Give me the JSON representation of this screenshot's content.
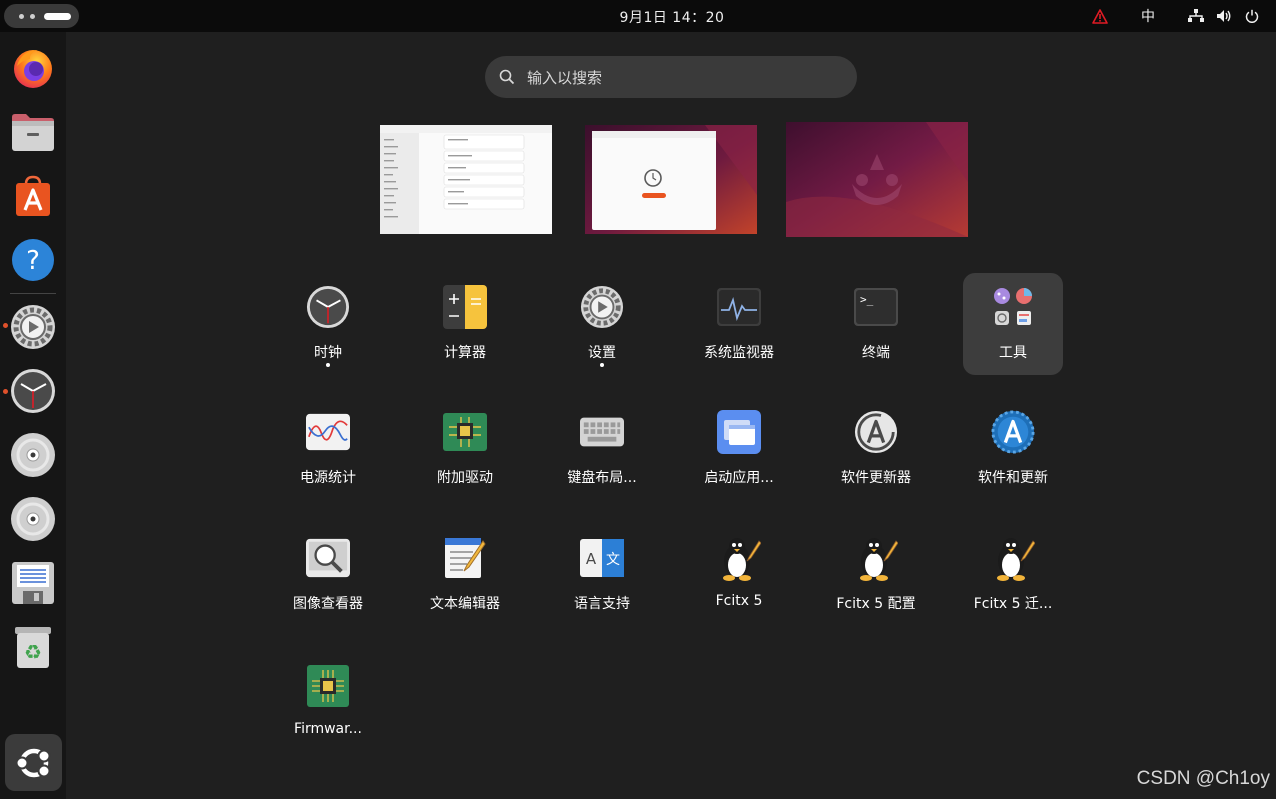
{
  "topbar": {
    "clock": "9月1日  14：20",
    "input_method": "中",
    "icons": [
      "warning-icon",
      "network-icon",
      "volume-icon",
      "power-icon"
    ]
  },
  "dock": {
    "items": [
      {
        "name": "firefox",
        "icon": "firefox-icon"
      },
      {
        "name": "files",
        "icon": "files-icon"
      },
      {
        "name": "app-center",
        "icon": "app-center-icon"
      },
      {
        "name": "help",
        "icon": "help-icon"
      },
      {
        "name": "settings",
        "icon": "settings-icon",
        "running": true
      },
      {
        "name": "clocks",
        "icon": "clock-icon",
        "running": true
      },
      {
        "name": "disc-1",
        "icon": "disc-icon"
      },
      {
        "name": "disc-2",
        "icon": "disc-icon"
      },
      {
        "name": "floppy",
        "icon": "floppy-icon"
      },
      {
        "name": "trash",
        "icon": "trash-icon"
      }
    ],
    "show_apps_icon": "ubuntu-logo-icon"
  },
  "search": {
    "placeholder": "输入以搜索"
  },
  "workspaces": [
    {
      "name": "workspace-1",
      "content": "settings-window"
    },
    {
      "name": "workspace-2",
      "content": "clock-window"
    },
    {
      "name": "workspace-3",
      "content": "empty-wallpaper"
    }
  ],
  "apps": [
    {
      "label": "时钟",
      "icon": "clock-icon",
      "running": true
    },
    {
      "label": "计算器",
      "icon": "calculator-icon"
    },
    {
      "label": "设置",
      "icon": "settings-icon",
      "running": true
    },
    {
      "label": "系统监视器",
      "icon": "system-monitor-icon"
    },
    {
      "label": "终端",
      "icon": "terminal-icon"
    },
    {
      "label": "工具",
      "icon": "utilities-folder-icon",
      "selected": true
    },
    {
      "label": "电源统计",
      "icon": "power-statistics-icon"
    },
    {
      "label": "附加驱动",
      "icon": "additional-drivers-icon"
    },
    {
      "label": "键盘布局...",
      "icon": "keyboard-icon"
    },
    {
      "label": "启动应用...",
      "icon": "startup-apps-icon"
    },
    {
      "label": "软件更新器",
      "icon": "software-updater-icon"
    },
    {
      "label": "软件和更新",
      "icon": "software-updates-icon"
    },
    {
      "label": "图像查看器",
      "icon": "image-viewer-icon"
    },
    {
      "label": "文本编辑器",
      "icon": "text-editor-icon"
    },
    {
      "label": "语言支持",
      "icon": "language-support-icon"
    },
    {
      "label": "Fcitx 5",
      "icon": "penguin-icon"
    },
    {
      "label": "Fcitx 5 配置",
      "icon": "penguin-icon"
    },
    {
      "label": "Fcitx 5 迁...",
      "icon": "penguin-icon"
    },
    {
      "label": "Firmwar...",
      "icon": "firmware-chip-icon"
    }
  ],
  "watermark": "CSDN @Ch1oy",
  "colors": {
    "ubuntu_orange": "#e95420",
    "running_indicator": "#e0512b",
    "warning_red": "#e01b24"
  }
}
